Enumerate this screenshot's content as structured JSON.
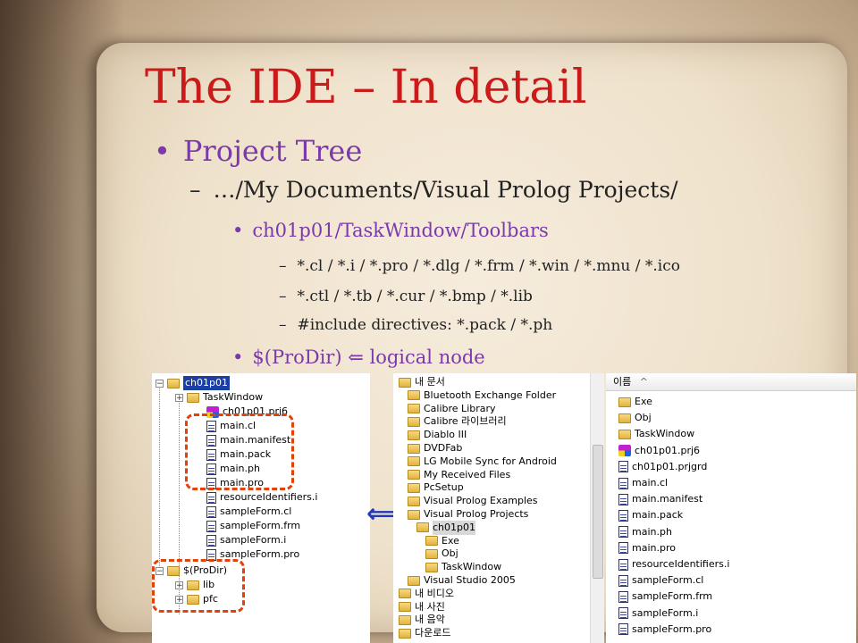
{
  "slide": {
    "title": "The IDE – In detail",
    "bullet_l1": "•",
    "bullet_l2": "–",
    "bullet_l3": "•",
    "bullet_l4": "–",
    "item_project_tree": "Project Tree",
    "item_path": "…/My Documents/Visual Prolog Projects/",
    "item_ch01p01": "ch01p01/TaskWindow/Toolbars",
    "sub_items": [
      "*.cl / *.i / *.pro / *.dlg / *.frm / *.win / *.mnu / *.ico",
      "*.ctl / *.tb / *.cur / *.bmp / *.lib",
      "#include directives: *.pack / *.ph"
    ],
    "item_prodir": "$(ProDir) ",
    "item_prodir_arrow": "⇐",
    "item_prodir_rest": " logical node",
    "double_arrow": "⟺",
    "colors": {
      "title": "#cc1a1a",
      "accent": "#7a3aa8",
      "highlight": "#e2420a"
    }
  },
  "project_tree": [
    {
      "label": "ch01p01",
      "icon": "folder-icon",
      "selected": true
    },
    {
      "label": "TaskWindow",
      "icon": "folder-icon"
    },
    {
      "label": "ch01p01.prj6",
      "icon": "project-icon"
    },
    {
      "label": "main.cl",
      "icon": "document-icon"
    },
    {
      "label": "main.manifest",
      "icon": "document-icon"
    },
    {
      "label": "main.pack",
      "icon": "document-icon"
    },
    {
      "label": "main.ph",
      "icon": "document-icon"
    },
    {
      "label": "main.pro",
      "icon": "document-icon"
    },
    {
      "label": "resourceIdentifiers.i",
      "icon": "document-icon"
    },
    {
      "label": "sampleForm.cl",
      "icon": "document-icon"
    },
    {
      "label": "sampleForm.frm",
      "icon": "document-icon"
    },
    {
      "label": "sampleForm.i",
      "icon": "document-icon"
    },
    {
      "label": "sampleForm.pro",
      "icon": "document-icon"
    },
    {
      "label": "$(ProDir)",
      "icon": "folder-icon"
    },
    {
      "label": "lib",
      "icon": "folder-icon"
    },
    {
      "label": "pfc",
      "icon": "folder-icon"
    }
  ],
  "explorer_tree": [
    {
      "label": "내 문서",
      "icon": "folder-icon"
    },
    {
      "label": "Bluetooth Exchange Folder",
      "icon": "folder-icon"
    },
    {
      "label": "Calibre Library",
      "icon": "folder-icon"
    },
    {
      "label": "Calibre 라이브러리",
      "icon": "folder-icon"
    },
    {
      "label": "Diablo III",
      "icon": "folder-icon"
    },
    {
      "label": "DVDFab",
      "icon": "folder-icon"
    },
    {
      "label": "LG Mobile Sync for Android",
      "icon": "folder-icon"
    },
    {
      "label": "My Received Files",
      "icon": "folder-icon"
    },
    {
      "label": "PcSetup",
      "icon": "folder-icon"
    },
    {
      "label": "Visual Prolog Examples",
      "icon": "folder-icon"
    },
    {
      "label": "Visual Prolog Projects",
      "icon": "folder-icon"
    },
    {
      "label": "ch01p01",
      "icon": "folder-icon",
      "selected": true
    },
    {
      "label": "Exe",
      "icon": "folder-icon"
    },
    {
      "label": "Obj",
      "icon": "folder-icon"
    },
    {
      "label": "TaskWindow",
      "icon": "folder-icon"
    },
    {
      "label": "Visual Studio 2005",
      "icon": "folder-icon"
    },
    {
      "label": "내 비디오",
      "icon": "folder-icon"
    },
    {
      "label": "내 사진",
      "icon": "folder-icon"
    },
    {
      "label": "내 음악",
      "icon": "folder-icon"
    },
    {
      "label": "다운로드",
      "icon": "folder-icon"
    }
  ],
  "file_list": {
    "header": "이름",
    "header_sort": "^",
    "items": [
      {
        "label": "Exe",
        "icon": "folder-icon"
      },
      {
        "label": "Obj",
        "icon": "folder-icon"
      },
      {
        "label": "TaskWindow",
        "icon": "folder-icon"
      },
      {
        "label": "ch01p01.prj6",
        "icon": "project-icon"
      },
      {
        "label": "ch01p01.prjgrd",
        "icon": "document-icon"
      },
      {
        "label": "main.cl",
        "icon": "document-icon"
      },
      {
        "label": "main.manifest",
        "icon": "document-icon"
      },
      {
        "label": "main.pack",
        "icon": "document-icon"
      },
      {
        "label": "main.ph",
        "icon": "document-icon"
      },
      {
        "label": "main.pro",
        "icon": "document-icon"
      },
      {
        "label": "resourceIdentifiers.i",
        "icon": "document-icon"
      },
      {
        "label": "sampleForm.cl",
        "icon": "document-icon"
      },
      {
        "label": "sampleForm.frm",
        "icon": "document-icon"
      },
      {
        "label": "sampleForm.i",
        "icon": "document-icon"
      },
      {
        "label": "sampleForm.pro",
        "icon": "document-icon"
      }
    ]
  }
}
